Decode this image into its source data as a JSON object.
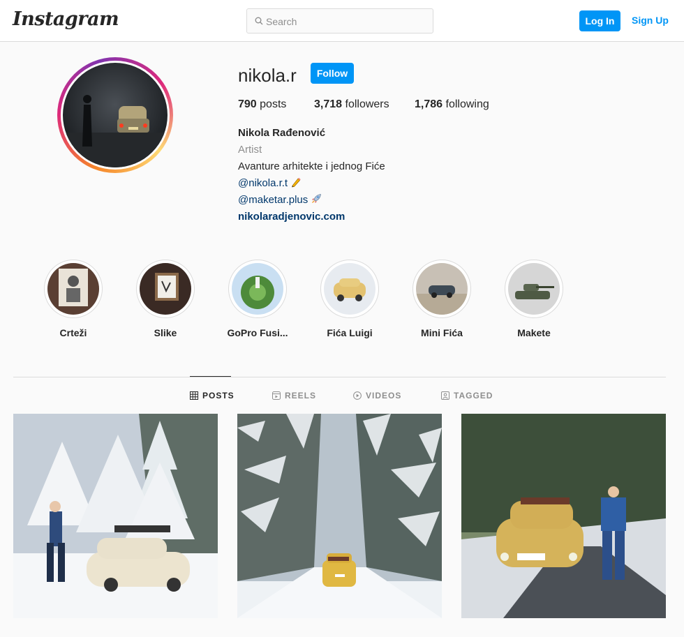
{
  "header": {
    "logo": "Instagram",
    "search_placeholder": "Search",
    "login_label": "Log In",
    "signup_label": "Sign Up",
    "accent_color": "#0095f6"
  },
  "profile": {
    "username": "nikola.r",
    "follow_label": "Follow",
    "stats": {
      "posts_count": "790",
      "posts_label": "posts",
      "followers_count": "3,718",
      "followers_label": "followers",
      "following_count": "1,786",
      "following_label": "following"
    },
    "bio": {
      "full_name": "Nikola Rađenović",
      "category": "Artist",
      "text": "Avanture arhitekte i jednog Fiće",
      "mention1": "@nikola.r.t",
      "mention1_icon": "pencil-icon",
      "mention2": "@maketar.plus",
      "mention2_icon": "rocket-icon",
      "website": "nikolaradjenovic.com"
    }
  },
  "highlights": [
    {
      "label": "Crteži"
    },
    {
      "label": "Slike"
    },
    {
      "label": "GoPro Fusi..."
    },
    {
      "label": "Fića Luigi"
    },
    {
      "label": "Mini Fića"
    },
    {
      "label": "Makete"
    }
  ],
  "tabs": [
    {
      "label": "POSTS",
      "icon": "grid-icon",
      "active": true
    },
    {
      "label": "REELS",
      "icon": "reels-icon",
      "active": false
    },
    {
      "label": "VIDEOS",
      "icon": "play-icon",
      "active": false
    },
    {
      "label": "TAGGED",
      "icon": "tag-icon",
      "active": false
    }
  ],
  "posts": [
    {
      "description": "snow-mountain-sculpture-yellow-car"
    },
    {
      "description": "snowy-forest-road-yellow-car"
    },
    {
      "description": "yellow-car-man-forest-road"
    }
  ]
}
